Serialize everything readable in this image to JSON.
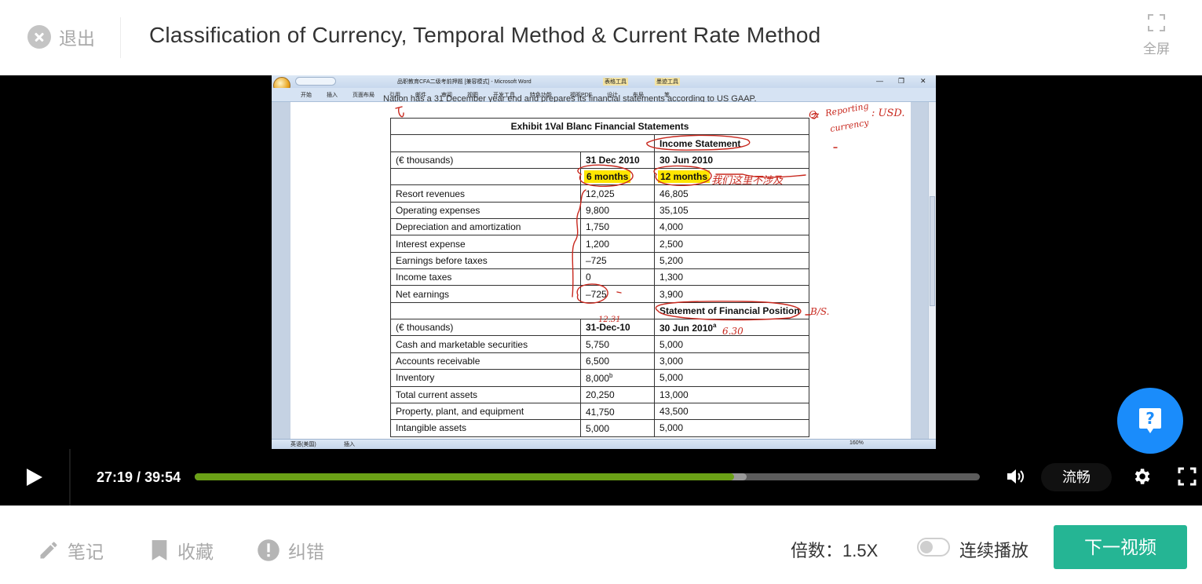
{
  "header": {
    "exit_label": "退出",
    "title": "Classification of Currency, Temporal Method & Current Rate Method",
    "fullscreen_label": "全屏"
  },
  "word": {
    "title": "品职教育CFA二级考前押题 [兼容模式] - Microsoft Word",
    "context_tabs": [
      "表格工具",
      "墨迹工具"
    ],
    "ribbon_tabs": [
      "开始",
      "插入",
      "页面布局",
      "引用",
      "邮件",
      "审阅",
      "视图",
      "开发工具",
      "特色功能",
      "福昕PDF",
      "设计",
      "布局",
      "笔"
    ],
    "status_lang": "英语(美国)",
    "status_mode": "插入",
    "zoom": "160%",
    "cut_text": "Nation has a 31 December year end and prepares its financial statements according to US GAAP."
  },
  "exhibit": {
    "caption": "Exhibit 1Val Blanc Financial Statements",
    "income_title": "Income Statement",
    "units_label": "(€ thousands)",
    "col_a_header": "31 Dec 2010",
    "col_b_header": "30 Jun 2010",
    "col_a_period": "6 months",
    "col_b_period": "12 months",
    "income_rows": [
      {
        "label": "Resort revenues",
        "a": "12,025",
        "b": "46,805"
      },
      {
        "label": "Operating expenses",
        "a": "9,800",
        "b": "35,105"
      },
      {
        "label": "Depreciation and amortization",
        "a": "1,750",
        "b": "4,000"
      },
      {
        "label": "Interest expense",
        "a": "1,200",
        "b": "2,500"
      },
      {
        "label": "Earnings before taxes",
        "a": "–725",
        "b": "5,200"
      },
      {
        "label": "Income taxes",
        "a": "0",
        "b": "1,300"
      },
      {
        "label": "Net earnings",
        "a": "–725",
        "b": "3,900"
      }
    ],
    "balance_title": "Statement of Financial Position",
    "balance_units_label": "(€ thousands)",
    "balance_col_a_header": "31-Dec-10",
    "balance_col_b_header": "30 Jun 2010",
    "balance_col_b_sup": "a",
    "balance_rows": [
      {
        "label": "Cash and marketable securities",
        "a": "5,750",
        "a_sup": "",
        "b": "5,000"
      },
      {
        "label": "Accounts receivable",
        "a": "6,500",
        "a_sup": "",
        "b": "3,000"
      },
      {
        "label": "Inventory",
        "a": "8,000",
        "a_sup": "b",
        "b": "5,000"
      },
      {
        "label": "Total current assets",
        "a": "20,250",
        "a_sup": "",
        "b": "13,000"
      },
      {
        "label": "Property, plant, and equipment",
        "a": "41,750",
        "a_sup": "",
        "b": "43,500"
      },
      {
        "label": "Intangible assets",
        "a": "5,000",
        "a_sup": "",
        "b": "5,000"
      }
    ]
  },
  "annotations": {
    "reporting": "Reporting",
    "currency": "currency",
    "usd": ": USD.",
    "q_mark": "Q:",
    "chinese_note": "我们这里不涉及",
    "date_1231": "12.31",
    "date_630": "6.30",
    "bs_mark": "B/S."
  },
  "player": {
    "current_time": "27:19",
    "total_time": "39:54",
    "played_fraction": 0.687,
    "buffered_fraction": 0.703,
    "quality": "流畅"
  },
  "bottom": {
    "notes_label": "笔记",
    "favorite_label": "收藏",
    "error_label": "纠错",
    "speed_label": "倍数：1.5X",
    "autoplay_label": "连续播放",
    "autoplay_on": false,
    "next_label": "下一视频"
  },
  "colors": {
    "progress_played": "#6aa016",
    "next_button": "#25b594",
    "help_button": "#1a8cfb",
    "highlight": "#ffe600",
    "annotation_ink": "#c8281e"
  }
}
